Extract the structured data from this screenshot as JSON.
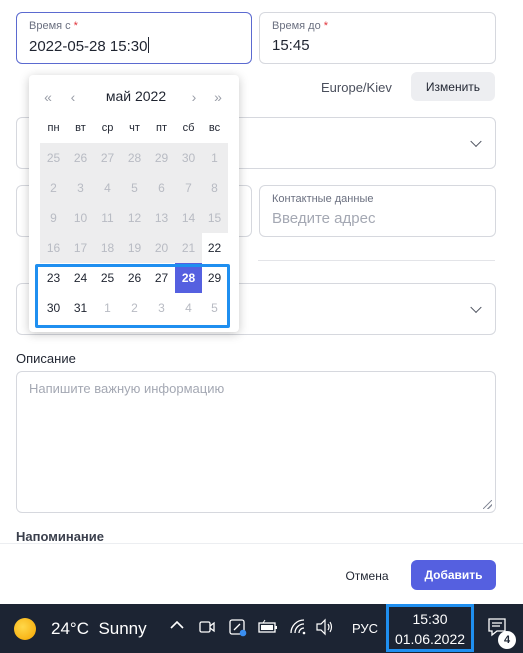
{
  "form": {
    "time_from": {
      "label": "Время с",
      "required_mark": "*",
      "value": "2022-05-28 15:30"
    },
    "time_to": {
      "label": "Время до",
      "required_mark": "*",
      "value": "15:45"
    },
    "timezone": "Europe/Kiev",
    "change_button": "Изменить",
    "contact": {
      "label": "Контактные данные",
      "placeholder": "Введите адрес"
    },
    "description": {
      "label": "Описание",
      "placeholder": "Напишите важную информацию"
    },
    "reminder_label": "Напоминание",
    "cancel_button": "Отмена",
    "add_button": "Добавить"
  },
  "datepicker": {
    "nav": {
      "prev_year": "«",
      "prev_month": "‹",
      "next_month": "›",
      "next_year": "»"
    },
    "title": "май  2022",
    "weekdays": [
      "пн",
      "вт",
      "ср",
      "чт",
      "пт",
      "сб",
      "вс"
    ],
    "days": [
      [
        "25",
        "26",
        "27",
        "28",
        "29",
        "30",
        "1"
      ],
      [
        "2",
        "3",
        "4",
        "5",
        "6",
        "7",
        "8"
      ],
      [
        "9",
        "10",
        "11",
        "12",
        "13",
        "14",
        "15"
      ],
      [
        "16",
        "17",
        "18",
        "19",
        "20",
        "21",
        "22"
      ],
      [
        "23",
        "24",
        "25",
        "26",
        "27",
        "28",
        "29"
      ],
      [
        "30",
        "31",
        "1",
        "2",
        "3",
        "4",
        "5"
      ]
    ],
    "selected": "28"
  },
  "taskbar": {
    "temperature": "24°C",
    "condition": "Sunny",
    "language": "РУС",
    "time": "15:30",
    "date": "01.06.2022",
    "notification_count": "4"
  },
  "colors": {
    "accent": "#5560e0",
    "highlight": "#1f8ff0",
    "taskbar": "#1c2433"
  }
}
